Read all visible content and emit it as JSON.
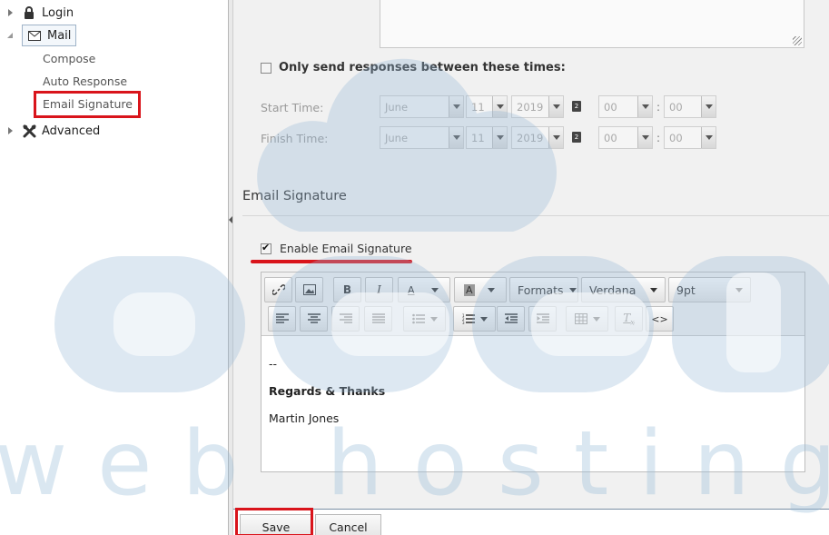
{
  "sidebar": {
    "items": [
      {
        "label": "Login",
        "icon": "lock-icon",
        "expanded": false
      },
      {
        "label": "Mail",
        "icon": "envelope-icon",
        "expanded": true,
        "children": [
          "Compose",
          "Auto Response",
          "Email Signature"
        ]
      },
      {
        "label": "Advanced",
        "icon": "tools-icon",
        "expanded": false
      }
    ],
    "highlighted_item": "Email Signature"
  },
  "schedule": {
    "only_send_label": "Only send responses between these times:",
    "only_send_checked": false,
    "start_label": "Start Time:",
    "finish_label": "Finish Time:",
    "start": {
      "month": "June",
      "day": "11",
      "year": "2019",
      "hour": "00",
      "minute": "00"
    },
    "finish": {
      "month": "June",
      "day": "11",
      "year": "2019",
      "hour": "00",
      "minute": "00"
    }
  },
  "signature": {
    "section_title": "Email Signature",
    "enable_label": "Enable Email Signature",
    "enabled": true,
    "toolbar": {
      "formats_label": "Formats",
      "font_label": "Verdana",
      "size_label": "9pt"
    },
    "content": {
      "line1": "--",
      "line2": "Regards & Thanks",
      "line3": "Martin Jones"
    }
  },
  "actions": {
    "save_label": "Save",
    "cancel_label": "Cancel"
  },
  "watermark": {
    "text": "web hosting"
  },
  "colors": {
    "highlight": "#d9141b",
    "watermark": "#96b9d7"
  }
}
